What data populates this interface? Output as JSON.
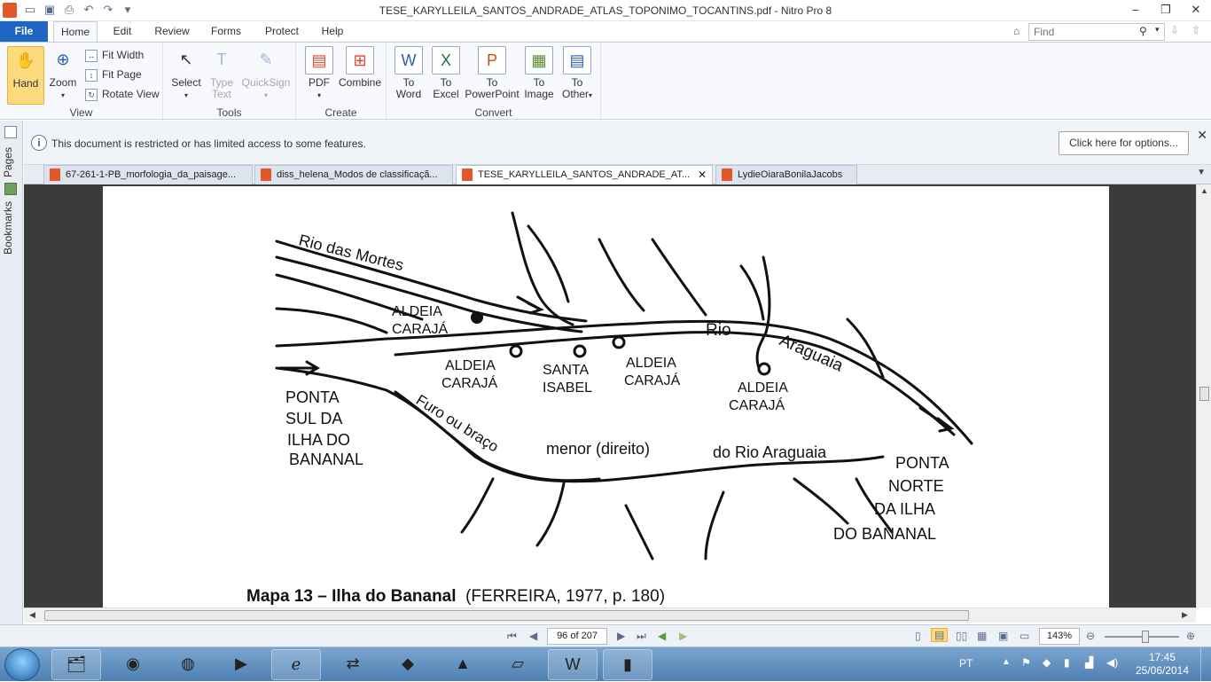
{
  "window": {
    "title": "TESE_KARYLLEILA_SANTOS_ANDRADE_ATLAS_TOPONIMO_TOCANTINS.pdf - Nitro Pro 8"
  },
  "ribbon_tabs": [
    "File",
    "Home",
    "Edit",
    "Review",
    "Forms",
    "Protect",
    "Help"
  ],
  "find": {
    "placeholder": "Find"
  },
  "ribbon": {
    "view": {
      "label": "View",
      "hand": "Hand",
      "zoom": "Zoom",
      "fit_width": "Fit Width",
      "fit_page": "Fit Page",
      "rotate_view": "Rotate View"
    },
    "tools": {
      "label": "Tools",
      "select": "Select",
      "type_text_1": "Type",
      "type_text_2": "Text",
      "quicksign": "QuickSign"
    },
    "create": {
      "label": "Create",
      "pdf": "PDF",
      "combine": "Combine"
    },
    "convert": {
      "label": "Convert",
      "to": "To",
      "word": "Word",
      "excel": "Excel",
      "powerpoint": "PowerPoint",
      "image": "Image",
      "other": "Other"
    }
  },
  "side_tabs": {
    "pages": "Pages",
    "bookmarks": "Bookmarks"
  },
  "infobar": {
    "message": "This document is restricted or has limited access to some features.",
    "options": "Click here for options..."
  },
  "doc_tabs": [
    "67-261-1-PB_morfologia_da_paisage...",
    "diss_helena_Modos de classificaçã...",
    "TESE_KARYLLEILA_SANTOS_ANDRADE_AT...",
    "LydieOiaraBonilaJacobs"
  ],
  "map": {
    "labels": [
      "Rio das Mortes",
      "ALDEIA",
      "CARAJÁ",
      "Rio",
      "Araguaia",
      "ALDEIA",
      "CARAJÁ",
      "SANTA",
      "ISABEL",
      "ALDEIA",
      "CARAJÁ",
      "ALDEIA",
      "CARAJÁ",
      "PONTA",
      "SUL DA",
      "ILHA DO",
      "BANANAL",
      "Furo ou braço",
      "menor (direito)",
      "do Rio Araguaia",
      "PONTA",
      "NORTE",
      "DA ILHA",
      "DO BANANAL"
    ]
  },
  "caption": {
    "bold": "Mapa 13 – Ilha do Bananal",
    "rest": "(FERREIRA, 1977, p. 180)"
  },
  "status": {
    "page": "96 of 207",
    "zoom": "143%"
  },
  "tray": {
    "lang": "PT",
    "time": "17:45",
    "date": "25/06/2014"
  }
}
